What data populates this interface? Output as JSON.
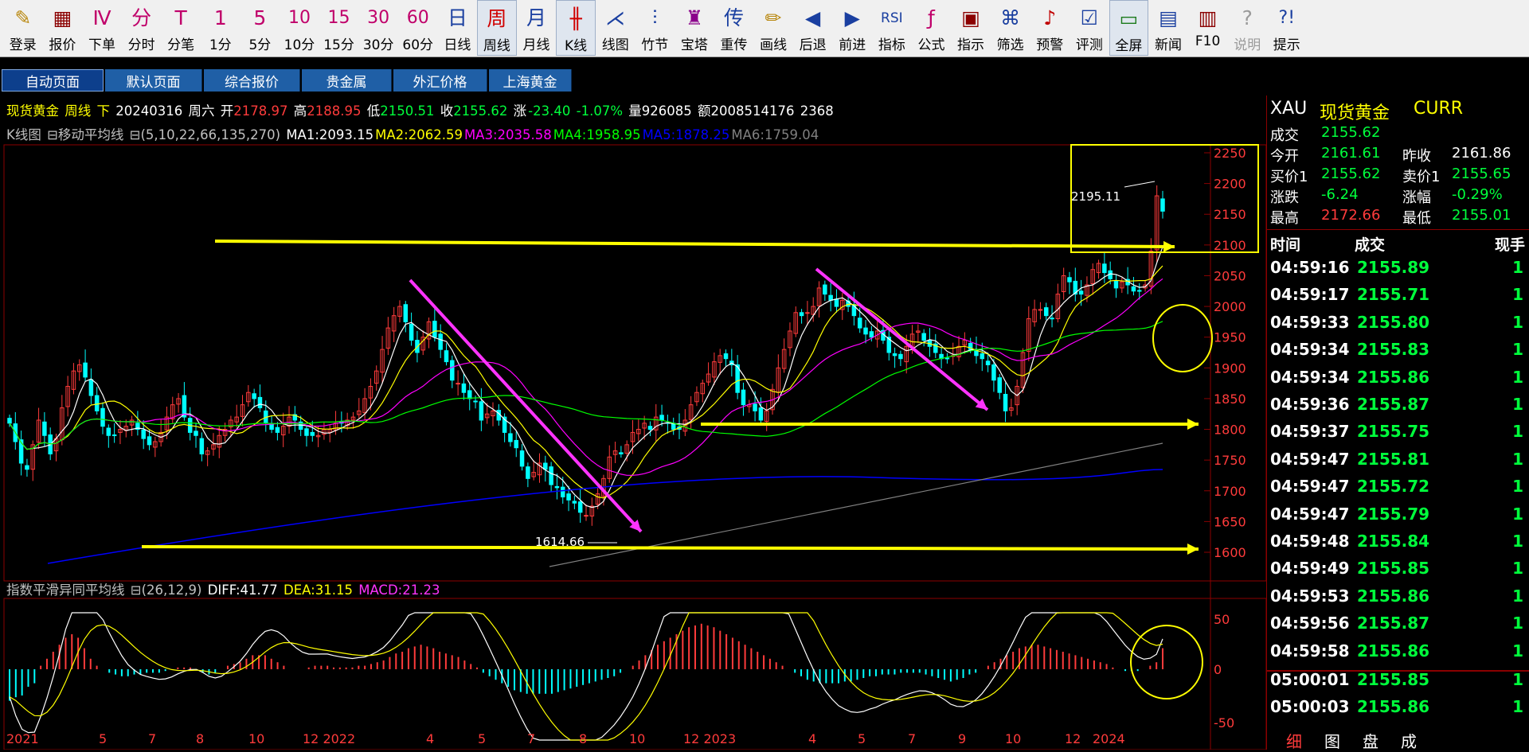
{
  "toolbar": [
    {
      "glyph": "✎",
      "label": "登录",
      "icon": "login-icon",
      "color": "#b8860b"
    },
    {
      "glyph": "▦",
      "label": "报价",
      "icon": "quote-icon",
      "color": "#8b0000"
    },
    {
      "glyph": "Ⅳ",
      "label": "下单",
      "icon": "order-icon",
      "color": "#c0006a"
    },
    {
      "glyph": "分",
      "label": "分时",
      "icon": "timeshare-icon",
      "color": "#c0006a"
    },
    {
      "glyph": "T",
      "label": "分笔",
      "icon": "tick-icon",
      "color": "#c0006a"
    },
    {
      "glyph": "1",
      "label": "1分",
      "icon": "1min-icon",
      "color": "#c0006a"
    },
    {
      "glyph": "5",
      "label": "5分",
      "icon": "5min-icon",
      "color": "#c0006a"
    },
    {
      "glyph": "10",
      "label": "10分",
      "icon": "10min-icon",
      "color": "#c0006a"
    },
    {
      "glyph": "15",
      "label": "15分",
      "icon": "15min-icon",
      "color": "#c0006a"
    },
    {
      "glyph": "30",
      "label": "30分",
      "icon": "30min-icon",
      "color": "#c0006a"
    },
    {
      "glyph": "60",
      "label": "60分",
      "icon": "60min-icon",
      "color": "#c0006a"
    },
    {
      "glyph": "日",
      "label": "日线",
      "icon": "daily-icon",
      "color": "#1a3fa0"
    },
    {
      "glyph": "周",
      "label": "周线",
      "icon": "weekly-icon",
      "color": "#d00000",
      "active": true
    },
    {
      "glyph": "月",
      "label": "月线",
      "icon": "monthly-icon",
      "color": "#1a3fa0"
    },
    {
      "glyph": "╫",
      "label": "K线",
      "icon": "kline-icon",
      "color": "#d00000",
      "active": true
    },
    {
      "glyph": "⋌",
      "label": "线图",
      "icon": "linechart-icon",
      "color": "#1a3fa0"
    },
    {
      "glyph": "⫶",
      "label": "竹节",
      "icon": "bamboo-icon",
      "color": "#1a3fa0"
    },
    {
      "glyph": "♜",
      "label": "宝塔",
      "icon": "tower-icon",
      "color": "#8b008b"
    },
    {
      "glyph": "传",
      "label": "重传",
      "icon": "retransmit-icon",
      "color": "#1a3fa0"
    },
    {
      "glyph": "✏",
      "label": "画线",
      "icon": "drawline-icon",
      "color": "#b8860b"
    },
    {
      "glyph": "◀",
      "label": "后退",
      "icon": "back-icon",
      "color": "#1a3fa0"
    },
    {
      "glyph": "▶",
      "label": "前进",
      "icon": "forward-icon",
      "color": "#1a3fa0"
    },
    {
      "glyph": "RSI",
      "label": "指标",
      "icon": "indicator-icon",
      "color": "#1a3fa0"
    },
    {
      "glyph": "ƒ",
      "label": "公式",
      "icon": "formula-icon",
      "color": "#c0006a"
    },
    {
      "glyph": "▣",
      "label": "指示",
      "icon": "indicate-icon",
      "color": "#8b0000"
    },
    {
      "glyph": "⌘",
      "label": "筛选",
      "icon": "filter-icon",
      "color": "#1a3fa0"
    },
    {
      "glyph": "♪",
      "label": "预警",
      "icon": "alert-icon",
      "color": "#c00000"
    },
    {
      "glyph": "☑",
      "label": "评测",
      "icon": "evaluate-icon",
      "color": "#1a3fa0"
    },
    {
      "glyph": "▭",
      "label": "全屏",
      "icon": "fullscreen-icon",
      "color": "#1a7a1a",
      "active": true
    },
    {
      "glyph": "▤",
      "label": "新闻",
      "icon": "news-icon",
      "color": "#1a3fa0"
    },
    {
      "glyph": "▥",
      "label": "F10",
      "icon": "f10-icon",
      "color": "#8b0000"
    },
    {
      "glyph": "?",
      "label": "说明",
      "icon": "help-icon",
      "color": "#9a9a9a",
      "disabled": true
    },
    {
      "glyph": "?!",
      "label": "提示",
      "icon": "tip-icon",
      "color": "#1a3fa0"
    }
  ],
  "tabs": [
    {
      "label": "自动页面",
      "active": true
    },
    {
      "label": "默认页面"
    },
    {
      "label": "综合报价"
    },
    {
      "label": "贵金属"
    },
    {
      "label": "外汇价格"
    },
    {
      "label": "上海黄金"
    }
  ],
  "header": {
    "name": "现货黄金",
    "period": "周线",
    "arrow": "下",
    "date": "20240316",
    "weekday": "周六",
    "open_label": "开",
    "open": "2178.97",
    "high_label": "高",
    "high": "2188.95",
    "low_label": "低",
    "low": "2150.51",
    "close_label": "收",
    "close": "2155.62",
    "change_label": "涨",
    "change": "-23.40",
    "change_pct": "-1.07%",
    "volume_label": "量",
    "volume": "926085",
    "amount_label": "额",
    "amount": "2008514176",
    "extra": "2368"
  },
  "ma_line": {
    "prefix": "K线图",
    "box_glyph": "⊟",
    "indicator": "移动平均线",
    "params": "⊟(5,10,22,66,135,270)",
    "items": [
      {
        "label": "MA1:2093.15",
        "color": "#ffffff"
      },
      {
        "label": "MA2:2062.59",
        "color": "#ffff00"
      },
      {
        "label": "MA3:2035.58",
        "color": "#ff00ff"
      },
      {
        "label": "MA4:1958.95",
        "color": "#00ff00"
      },
      {
        "label": "MA5:1878.25",
        "color": "#0000ff"
      },
      {
        "label": "MA6:1759.04",
        "color": "#808080"
      }
    ]
  },
  "macd_line": {
    "indicator": "指数平滑异同平均线",
    "params": "⊟(26,12,9)",
    "diff": "DIFF:41.77",
    "dea": "DEA:31.15",
    "macd": "MACD:21.23"
  },
  "chart_data": {
    "type": "candlestick",
    "y_axis": {
      "ticks": [
        "2250",
        "2200",
        "2150",
        "2100",
        "2050",
        "2000",
        "1950",
        "1900",
        "1850",
        "1800",
        "1750",
        "1700",
        "1650",
        "1600"
      ],
      "range": [
        1580,
        2260
      ]
    },
    "x_axis": {
      "labels": [
        "2021",
        "5",
        "7",
        "8",
        "10",
        "12 2022",
        "4",
        "5",
        "7",
        "8",
        "10",
        "12 2023",
        "4",
        "5",
        "7",
        "9",
        "10",
        "12",
        "2024"
      ]
    },
    "annotations": {
      "high_label": "2195.11",
      "low_label": "1614.66"
    },
    "macd_axis": {
      "ticks": [
        "50",
        "0",
        "-50"
      ]
    },
    "colors": {
      "up": "#ff3b3b",
      "down": "#00ffff",
      "ma1": "#ffffff",
      "ma2": "#ffff00",
      "ma3": "#ff00ff",
      "ma4": "#00ff00",
      "ma5": "#0000ff",
      "ma6": "#808080",
      "arrow_yellow": "#ffff00",
      "arrow_pink": "#ff33ff",
      "grid": "#8b0000"
    },
    "close_series": [
      1810,
      1780,
      1745,
      1735,
      1775,
      1815,
      1790,
      1760,
      1785,
      1835,
      1870,
      1895,
      1905,
      1885,
      1855,
      1830,
      1805,
      1790,
      1790,
      1800,
      1805,
      1815,
      1800,
      1785,
      1775,
      1780,
      1795,
      1820,
      1840,
      1850,
      1820,
      1795,
      1790,
      1760,
      1765,
      1775,
      1790,
      1800,
      1815,
      1820,
      1840,
      1860,
      1850,
      1835,
      1810,
      1800,
      1795,
      1805,
      1820,
      1815,
      1800,
      1790,
      1790,
      1790,
      1800,
      1800,
      1810,
      1810,
      1815,
      1820,
      1830,
      1850,
      1870,
      1895,
      1930,
      1965,
      1985,
      2000,
      1975,
      1945,
      1925,
      1950,
      1975,
      1950,
      1930,
      1910,
      1880,
      1875,
      1860,
      1850,
      1845,
      1815,
      1825,
      1830,
      1815,
      1795,
      1780,
      1770,
      1740,
      1720,
      1730,
      1745,
      1735,
      1710,
      1705,
      1690,
      1685,
      1680,
      1665,
      1660,
      1675,
      1695,
      1720,
      1755,
      1765,
      1760,
      1775,
      1795,
      1800,
      1810,
      1800,
      1820,
      1815,
      1810,
      1800,
      1800,
      1815,
      1840,
      1860,
      1875,
      1890,
      1910,
      1920,
      1915,
      1905,
      1860,
      1840,
      1840,
      1830,
      1815,
      1830,
      1865,
      1900,
      1930,
      1960,
      1990,
      1985,
      1990,
      2000,
      2030,
      2020,
      2010,
      2000,
      2010,
      2000,
      1985,
      1965,
      1955,
      1950,
      1960,
      1945,
      1925,
      1920,
      1915,
      1935,
      1955,
      1960,
      1945,
      1935,
      1925,
      1915,
      1915,
      1920,
      1935,
      1945,
      1930,
      1920,
      1915,
      1905,
      1880,
      1860,
      1830,
      1835,
      1870,
      1925,
      1980,
      1995,
      1995,
      1985,
      1980,
      2020,
      2050,
      2040,
      2020,
      2020,
      2035,
      2060,
      2070,
      2055,
      2045,
      2030,
      2040,
      2035,
      2025,
      2025,
      2035,
      2090,
      2180,
      2155
    ],
    "macd_hist": [
      -18,
      -16,
      -15,
      -10,
      -8,
      2,
      6,
      10,
      14,
      18,
      20,
      18,
      12,
      6,
      2,
      0,
      -2,
      -3,
      -4,
      -4,
      -3,
      -3,
      -2,
      -2,
      -2,
      -1,
      0,
      1,
      1,
      1,
      0,
      -2,
      -3,
      -2,
      0,
      2,
      3,
      4,
      6,
      8,
      8,
      8,
      6,
      4,
      2,
      0,
      0,
      0,
      1,
      2,
      2,
      2,
      1,
      1,
      1,
      1,
      2,
      2,
      3,
      4,
      5,
      7,
      9,
      10,
      12,
      13,
      14,
      13,
      12,
      10,
      9,
      8,
      7,
      5,
      3,
      1,
      -2,
      -4,
      -6,
      -8,
      -10,
      -12,
      -13,
      -14,
      -14,
      -14,
      -14,
      -14,
      -13,
      -12,
      -11,
      -10,
      -9,
      -8,
      -7,
      -6,
      -5,
      -4,
      -2,
      0,
      2,
      5,
      8,
      11,
      14,
      16,
      18,
      20,
      22,
      24,
      25,
      26,
      25,
      24,
      22,
      20,
      18,
      16,
      14,
      12,
      10,
      8,
      6,
      4,
      2,
      0,
      -2,
      -4,
      -6,
      -7,
      -8,
      -8,
      -8,
      -8,
      -7,
      -7,
      -6,
      -5,
      -4,
      -4,
      -3,
      -3,
      -3,
      -2,
      -2,
      -2,
      -2,
      -3,
      -4,
      -5,
      -6,
      -7,
      -6,
      -5,
      -3,
      -2,
      0,
      2,
      4,
      6,
      8,
      10,
      12,
      13,
      14,
      14,
      13,
      12,
      11,
      10,
      9,
      8,
      7,
      6,
      5,
      4,
      3,
      1,
      0,
      -1,
      -1,
      -1,
      0,
      2,
      4,
      12
    ]
  },
  "right": {
    "symbol": "XAU",
    "name": "现货黄金",
    "currency": "CURR",
    "fields": [
      {
        "l1": "成交",
        "v1": "2155.62",
        "c1": "#00ff3c"
      },
      {
        "l1": "今开",
        "v1": "2161.61",
        "c1": "#00ff3c",
        "l2": "昨收",
        "v2": "2161.86",
        "c2": "#ffffff"
      },
      {
        "l1": "买价1",
        "v1": "2155.62",
        "c1": "#00ff3c",
        "l2": "卖价1",
        "v2": "2155.65",
        "c2": "#00ff3c"
      },
      {
        "l1": "涨跌",
        "v1": "-6.24",
        "c1": "#00ff3c",
        "l2": "涨幅",
        "v2": "-0.29%",
        "c2": "#00ff3c"
      },
      {
        "l1": "最高",
        "v1": "2172.66",
        "c1": "#ff3b3b",
        "l2": "最低",
        "v2": "2155.01",
        "c2": "#00ff3c"
      }
    ],
    "tick_header": {
      "time": "时间",
      "price": "成交",
      "qty": "现手"
    },
    "ticks": [
      {
        "time": "04:59:16",
        "price": "2155.89",
        "qty": "1"
      },
      {
        "time": "04:59:17",
        "price": "2155.71",
        "qty": "1"
      },
      {
        "time": "04:59:33",
        "price": "2155.80",
        "qty": "1"
      },
      {
        "time": "04:59:34",
        "price": "2155.83",
        "qty": "1"
      },
      {
        "time": "04:59:34",
        "price": "2155.86",
        "qty": "1"
      },
      {
        "time": "04:59:36",
        "price": "2155.87",
        "qty": "1"
      },
      {
        "time": "04:59:37",
        "price": "2155.75",
        "qty": "1"
      },
      {
        "time": "04:59:47",
        "price": "2155.81",
        "qty": "1"
      },
      {
        "time": "04:59:47",
        "price": "2155.72",
        "qty": "1"
      },
      {
        "time": "04:59:47",
        "price": "2155.79",
        "qty": "1"
      },
      {
        "time": "04:59:48",
        "price": "2155.84",
        "qty": "1"
      },
      {
        "time": "04:59:49",
        "price": "2155.85",
        "qty": "1"
      },
      {
        "time": "04:59:53",
        "price": "2155.86",
        "qty": "1"
      },
      {
        "time": "04:59:56",
        "price": "2155.87",
        "qty": "1"
      },
      {
        "time": "04:59:58",
        "price": "2155.86",
        "qty": "1"
      }
    ],
    "ticks_after": [
      {
        "time": "05:00:01",
        "price": "2155.85",
        "qty": "1"
      },
      {
        "time": "05:00:03",
        "price": "2155.86",
        "qty": "1"
      }
    ],
    "bottom_tabs": [
      "细",
      "图",
      "盘",
      "成"
    ]
  }
}
